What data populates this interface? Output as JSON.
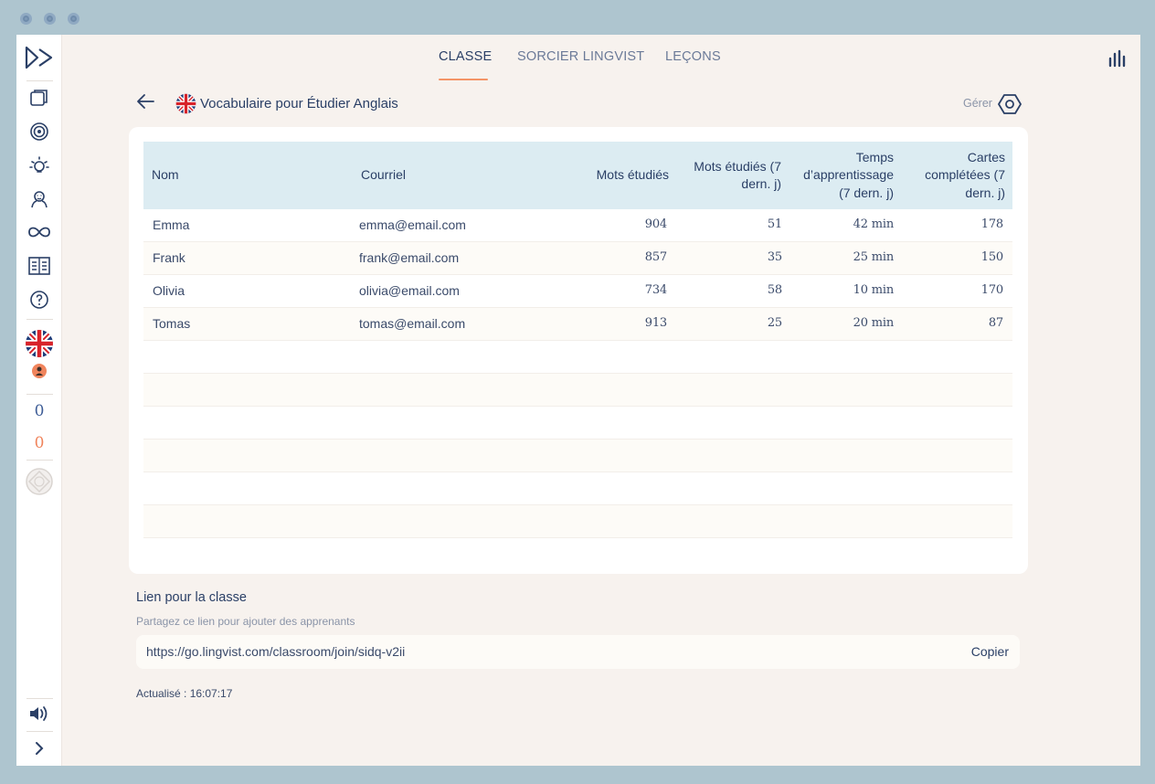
{
  "nav": {
    "tabs": [
      {
        "label": "CLASSE",
        "active": true
      },
      {
        "label": "SORCIER LINGVIST",
        "active": false
      },
      {
        "label": "LEÇONS",
        "active": false
      }
    ]
  },
  "sidebar": {
    "counters": {
      "blue": "0",
      "orange": "0"
    },
    "icons": [
      "lingvist-logo-icon",
      "cards-icon",
      "target-icon",
      "lightbulb-icon",
      "challenges-icon",
      "infinity-icon",
      "book-icon",
      "help-icon",
      "uk-flag-icon",
      "avatar-icon",
      "coin-icon",
      "speaker-icon",
      "chevron-right-icon"
    ]
  },
  "header": {
    "course_title": "Vocabulaire pour Étudier Anglais",
    "manage_label": "Gérer"
  },
  "table": {
    "columns": [
      "Nom",
      "Courriel",
      "Mots étudiés",
      "Mots étudiés (7 dern. j)",
      "Temps d’apprentissage (7 dern. j)",
      "Cartes complétées (7 dern. j)"
    ],
    "rows": [
      [
        "Emma",
        "emma@email.com",
        "904",
        "51",
        "42 min",
        "178"
      ],
      [
        "Frank",
        "frank@email.com",
        "857",
        "35",
        "25 min",
        "150"
      ],
      [
        "Olivia",
        "olivia@email.com",
        "734",
        "58",
        "10 min",
        "170"
      ],
      [
        "Tomas",
        "tomas@email.com",
        "913",
        "25",
        "20 min",
        "87"
      ]
    ]
  },
  "class_link": {
    "title": "Lien pour la classe",
    "subtitle": "Partagez ce lien pour ajouter des apprenants",
    "url": "https://go.lingvist.com/classroom/join/sidq-v2ii",
    "copy_label": "Copier"
  },
  "updated": "Actualisé : 16:07:17",
  "colors": {
    "accent": "#f49467",
    "navy": "#2a3f66",
    "table_header": "#dcecf2",
    "background": "#f7f2ee"
  }
}
